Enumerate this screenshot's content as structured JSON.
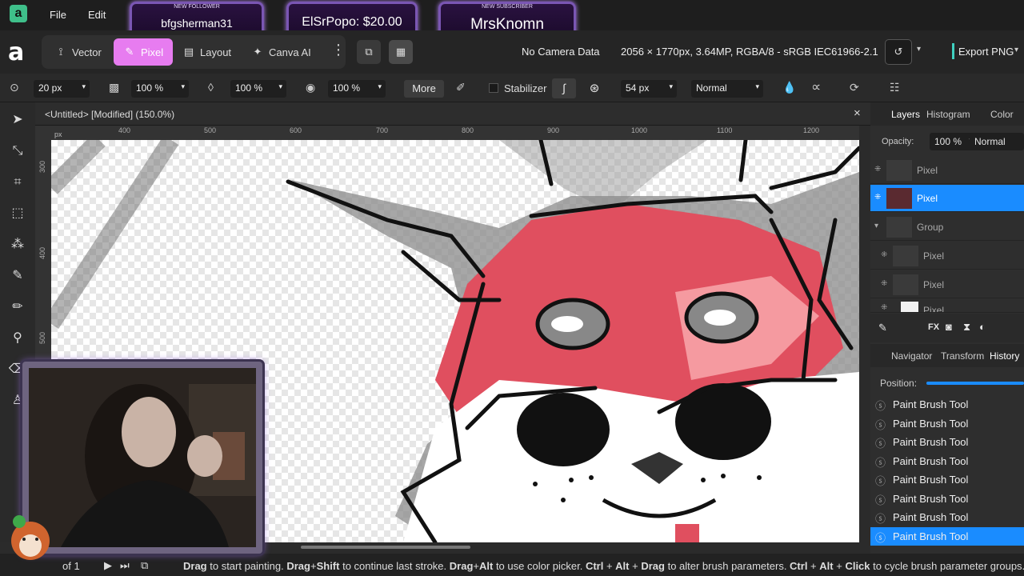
{
  "menu": {
    "file": "File",
    "edit": "Edit"
  },
  "alerts": [
    {
      "tag": "NEW FOLLOWER",
      "name": "bfgsherman31"
    },
    {
      "tag": "",
      "name": "ElSrPopo: $20.00"
    },
    {
      "tag": "NEW SUBSCRIBER",
      "name": "MrsKnomn"
    }
  ],
  "personas": {
    "vector": "Vector",
    "pixel": "Pixel",
    "layout": "Layout",
    "canva_ai": "Canva AI"
  },
  "doc_info": {
    "camera": "No Camera Data",
    "details": "2056 × 1770px, 3.64MP, RGBA/8 - sRGB IEC61966-2.1"
  },
  "export_label": "Export PNG",
  "context": {
    "size": "20 px",
    "opacity": "100 %",
    "flow": "100 %",
    "hardness": "100 %",
    "more": "More",
    "stabilizer": "Stabilizer",
    "distance": "54 px",
    "blend": "Normal"
  },
  "document": {
    "title": "<Untitled> [Modified] (150.0%)",
    "close": "×"
  },
  "ruler": {
    "unit": "px",
    "h_ticks": [
      "400",
      "500",
      "600",
      "700",
      "800",
      "900",
      "1000",
      "1100",
      "1200"
    ],
    "v_ticks": [
      "300",
      "400",
      "500"
    ]
  },
  "layers_panel": {
    "tabs": [
      "Layers",
      "Histogram",
      "Color"
    ],
    "opacity_label": "Opacity:",
    "opacity_value": "100 %",
    "blend": "Normal",
    "rows": [
      {
        "name": "Pixel"
      },
      {
        "name": "Pixel"
      },
      {
        "name": "Group"
      },
      {
        "name": "Pixel"
      },
      {
        "name": "Pixel"
      },
      {
        "name": "Pixel"
      }
    ]
  },
  "history_panel": {
    "tabs": [
      "Navigator",
      "Transform",
      "History"
    ],
    "position_label": "Position:",
    "items": [
      "Paint Brush Tool",
      "Paint Brush Tool",
      "Paint Brush Tool",
      "Paint Brush Tool",
      "Paint Brush Tool",
      "Paint Brush Tool",
      "Paint Brush Tool",
      "Paint Brush Tool"
    ]
  },
  "status": {
    "page": "of 1",
    "parts": [
      {
        "b": "Drag",
        "t": " to start painting. "
      },
      {
        "b": "Drag",
        "t": "+"
      },
      {
        "b": "Shift",
        "t": " to continue last stroke. "
      },
      {
        "b": "Drag",
        "t": "+"
      },
      {
        "b": "Alt",
        "t": " to use color picker. "
      },
      {
        "b": "Ctrl",
        "t": " + "
      },
      {
        "b": "Alt",
        "t": " + "
      },
      {
        "b": "Drag",
        "t": " to alter brush parameters. "
      },
      {
        "b": "Ctrl",
        "t": " + "
      },
      {
        "b": "Alt",
        "t": " + "
      },
      {
        "b": "Click",
        "t": " to cycle brush parameter groups."
      }
    ]
  },
  "colors": {
    "accent": "#1a8cff",
    "pixel_persona": "#e77cf0",
    "mask_red": "#e04f5f"
  }
}
